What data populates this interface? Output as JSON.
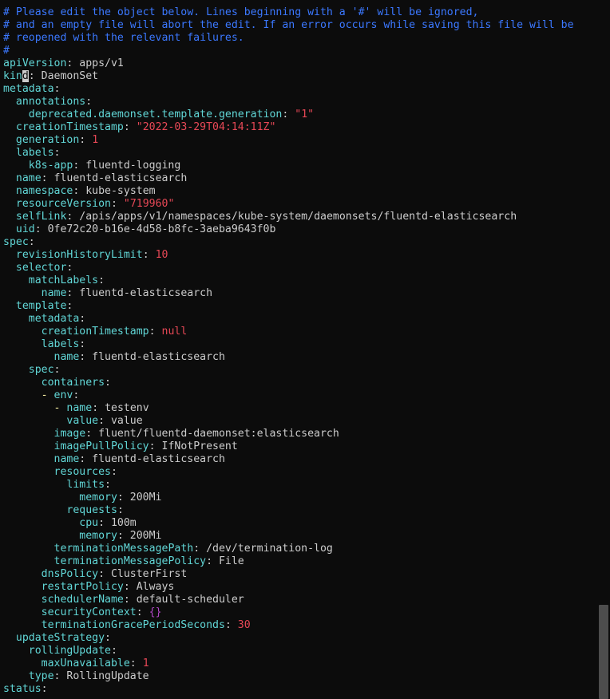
{
  "editor": {
    "lines": [
      [
        [
          "c",
          "# Please edit the object below. Lines beginning with a '#' will be ignored,"
        ]
      ],
      [
        [
          "c",
          "# and an empty file will abort the edit. If an error occurs while saving this file will be"
        ]
      ],
      [
        [
          "c",
          "# reopened with the relevant failures."
        ]
      ],
      [
        [
          "c",
          "#"
        ]
      ],
      [
        [
          "k",
          "apiVersion"
        ],
        [
          "t",
          ": apps/v1"
        ]
      ],
      [
        [
          "k",
          "kin"
        ],
        [
          "cur",
          "d"
        ],
        [
          "t",
          ": DaemonSet"
        ]
      ],
      [
        [
          "k",
          "metadata"
        ],
        [
          "t",
          ":"
        ]
      ],
      [
        [
          "t",
          "  "
        ],
        [
          "k",
          "annotations"
        ],
        [
          "t",
          ":"
        ]
      ],
      [
        [
          "t",
          "    "
        ],
        [
          "k",
          "deprecated.daemonset.template.generation"
        ],
        [
          "t",
          ": "
        ],
        [
          "s",
          "\"1\""
        ]
      ],
      [
        [
          "t",
          "  "
        ],
        [
          "k",
          "creationTimestamp"
        ],
        [
          "t",
          ": "
        ],
        [
          "s",
          "\"2022-03-29T04:14:11Z\""
        ]
      ],
      [
        [
          "t",
          "  "
        ],
        [
          "k",
          "generation"
        ],
        [
          "t",
          ": "
        ],
        [
          "n",
          "1"
        ]
      ],
      [
        [
          "t",
          "  "
        ],
        [
          "k",
          "labels"
        ],
        [
          "t",
          ":"
        ]
      ],
      [
        [
          "t",
          "    "
        ],
        [
          "k",
          "k8s-app"
        ],
        [
          "t",
          ": fluentd-logging"
        ]
      ],
      [
        [
          "t",
          "  "
        ],
        [
          "k",
          "name"
        ],
        [
          "t",
          ": fluentd-elasticsearch"
        ]
      ],
      [
        [
          "t",
          "  "
        ],
        [
          "k",
          "namespace"
        ],
        [
          "t",
          ": kube-system"
        ]
      ],
      [
        [
          "t",
          "  "
        ],
        [
          "k",
          "resourceVersion"
        ],
        [
          "t",
          ": "
        ],
        [
          "s",
          "\"719960\""
        ]
      ],
      [
        [
          "t",
          "  "
        ],
        [
          "k",
          "selfLink"
        ],
        [
          "t",
          ": /apis/apps/v1/namespaces/kube-system/daemonsets/fluentd-elasticsearch"
        ]
      ],
      [
        [
          "t",
          "  "
        ],
        [
          "k",
          "uid"
        ],
        [
          "t",
          ": 0fe72c20-b16e-4d58-b8fc-3aeba9643f0b"
        ]
      ],
      [
        [
          "k",
          "spec"
        ],
        [
          "t",
          ":"
        ]
      ],
      [
        [
          "t",
          "  "
        ],
        [
          "k",
          "revisionHistoryLimit"
        ],
        [
          "t",
          ": "
        ],
        [
          "n",
          "10"
        ]
      ],
      [
        [
          "t",
          "  "
        ],
        [
          "k",
          "selector"
        ],
        [
          "t",
          ":"
        ]
      ],
      [
        [
          "t",
          "    "
        ],
        [
          "k",
          "matchLabels"
        ],
        [
          "t",
          ":"
        ]
      ],
      [
        [
          "t",
          "      "
        ],
        [
          "k",
          "name"
        ],
        [
          "t",
          ": fluentd-elasticsearch"
        ]
      ],
      [
        [
          "t",
          "  "
        ],
        [
          "k",
          "template"
        ],
        [
          "t",
          ":"
        ]
      ],
      [
        [
          "t",
          "    "
        ],
        [
          "k",
          "metadata"
        ],
        [
          "t",
          ":"
        ]
      ],
      [
        [
          "t",
          "      "
        ],
        [
          "k",
          "creationTimestamp"
        ],
        [
          "t",
          ": "
        ],
        [
          "n",
          "null"
        ]
      ],
      [
        [
          "t",
          "      "
        ],
        [
          "k",
          "labels"
        ],
        [
          "t",
          ":"
        ]
      ],
      [
        [
          "t",
          "        "
        ],
        [
          "k",
          "name"
        ],
        [
          "t",
          ": fluentd-elasticsearch"
        ]
      ],
      [
        [
          "t",
          "    "
        ],
        [
          "k",
          "spec"
        ],
        [
          "t",
          ":"
        ]
      ],
      [
        [
          "t",
          "      "
        ],
        [
          "k",
          "containers"
        ],
        [
          "t",
          ":"
        ]
      ],
      [
        [
          "t",
          "      "
        ],
        [
          "d",
          "- "
        ],
        [
          "k",
          "env"
        ],
        [
          "t",
          ":"
        ]
      ],
      [
        [
          "t",
          "        "
        ],
        [
          "d",
          "- "
        ],
        [
          "k",
          "name"
        ],
        [
          "t",
          ": testenv"
        ]
      ],
      [
        [
          "t",
          "          "
        ],
        [
          "k",
          "value"
        ],
        [
          "t",
          ": value"
        ]
      ],
      [
        [
          "t",
          "        "
        ],
        [
          "k",
          "image"
        ],
        [
          "t",
          ": fluent/fluentd-daemonset:elasticsearch"
        ]
      ],
      [
        [
          "t",
          "        "
        ],
        [
          "k",
          "imagePullPolicy"
        ],
        [
          "t",
          ": IfNotPresent"
        ]
      ],
      [
        [
          "t",
          "        "
        ],
        [
          "k",
          "name"
        ],
        [
          "t",
          ": fluentd-elasticsearch"
        ]
      ],
      [
        [
          "t",
          "        "
        ],
        [
          "k",
          "resources"
        ],
        [
          "t",
          ":"
        ]
      ],
      [
        [
          "t",
          "          "
        ],
        [
          "k",
          "limits"
        ],
        [
          "t",
          ":"
        ]
      ],
      [
        [
          "t",
          "            "
        ],
        [
          "k",
          "memory"
        ],
        [
          "t",
          ": 200Mi"
        ]
      ],
      [
        [
          "t",
          "          "
        ],
        [
          "k",
          "requests"
        ],
        [
          "t",
          ":"
        ]
      ],
      [
        [
          "t",
          "            "
        ],
        [
          "k",
          "cpu"
        ],
        [
          "t",
          ": 100m"
        ]
      ],
      [
        [
          "t",
          "            "
        ],
        [
          "k",
          "memory"
        ],
        [
          "t",
          ": 200Mi"
        ]
      ],
      [
        [
          "t",
          "        "
        ],
        [
          "k",
          "terminationMessagePath"
        ],
        [
          "t",
          ": /dev/termination-log"
        ]
      ],
      [
        [
          "t",
          "        "
        ],
        [
          "k",
          "terminationMessagePolicy"
        ],
        [
          "t",
          ": File"
        ]
      ],
      [
        [
          "t",
          "      "
        ],
        [
          "k",
          "dnsPolicy"
        ],
        [
          "t",
          ": ClusterFirst"
        ]
      ],
      [
        [
          "t",
          "      "
        ],
        [
          "k",
          "restartPolicy"
        ],
        [
          "t",
          ": Always"
        ]
      ],
      [
        [
          "t",
          "      "
        ],
        [
          "k",
          "schedulerName"
        ],
        [
          "t",
          ": default-scheduler"
        ]
      ],
      [
        [
          "t",
          "      "
        ],
        [
          "k",
          "securityContext"
        ],
        [
          "t",
          ": "
        ],
        [
          "b",
          "{}"
        ]
      ],
      [
        [
          "t",
          "      "
        ],
        [
          "k",
          "terminationGracePeriodSeconds"
        ],
        [
          "t",
          ": "
        ],
        [
          "n",
          "30"
        ]
      ],
      [
        [
          "t",
          "  "
        ],
        [
          "k",
          "updateStrategy"
        ],
        [
          "t",
          ":"
        ]
      ],
      [
        [
          "t",
          "    "
        ],
        [
          "k",
          "rollingUpdate"
        ],
        [
          "t",
          ":"
        ]
      ],
      [
        [
          "t",
          "      "
        ],
        [
          "k",
          "maxUnavailable"
        ],
        [
          "t",
          ": "
        ],
        [
          "n",
          "1"
        ]
      ],
      [
        [
          "t",
          "    "
        ],
        [
          "k",
          "type"
        ],
        [
          "t",
          ": RollingUpdate"
        ]
      ],
      [
        [
          "k",
          "status"
        ],
        [
          "t",
          ":"
        ]
      ]
    ]
  },
  "colors": {
    "background": "#0c0c0c",
    "comment": "#3b78ff",
    "key": "#61d6d6",
    "text": "#cccccc",
    "number": "#e74856",
    "string": "#e74856",
    "dash": "#f9f1a5",
    "brace": "#b148c6"
  }
}
